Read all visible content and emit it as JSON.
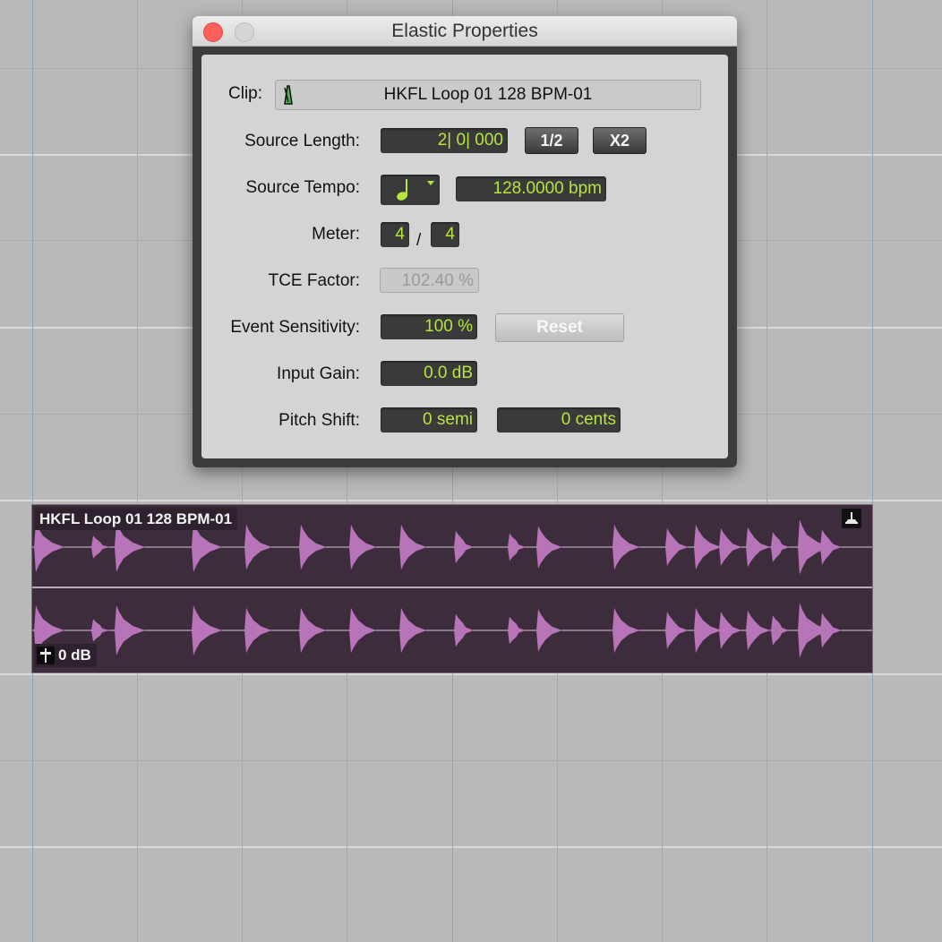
{
  "dialog": {
    "title": "Elastic Properties",
    "clip_label": "Clip:",
    "clip_name": "HKFL Loop 01 128 BPM-01",
    "source_length_label": "Source Length:",
    "source_length_value": "2| 0| 000",
    "half_button": "1/2",
    "double_button": "X2",
    "source_tempo_label": "Source Tempo:",
    "tempo_note_icon": "quarter-note-icon",
    "source_tempo_value": "128.0000 bpm",
    "meter_label": "Meter:",
    "meter_numerator": "4",
    "meter_separator": "/",
    "meter_denominator": "4",
    "tce_label": "TCE Factor:",
    "tce_value": "102.40 %",
    "event_sensitivity_label": "Event Sensitivity:",
    "event_sensitivity_value": "100 %",
    "reset_button": "Reset",
    "input_gain_label": "Input Gain:",
    "input_gain_value": "0.0 dB",
    "pitch_shift_label": "Pitch Shift:",
    "pitch_semi_value": "0 semi",
    "pitch_cents_value": "0 cents"
  },
  "clip": {
    "name": "HKFL Loop 01 128 BPM-01",
    "gain": "0 dB",
    "waveform_color": "#b774b9",
    "background_color": "#3c2c3c"
  },
  "colors": {
    "value_text": "#b6e63c",
    "timeline_background": "#b9b9b9",
    "close_button": "#fc605b"
  }
}
